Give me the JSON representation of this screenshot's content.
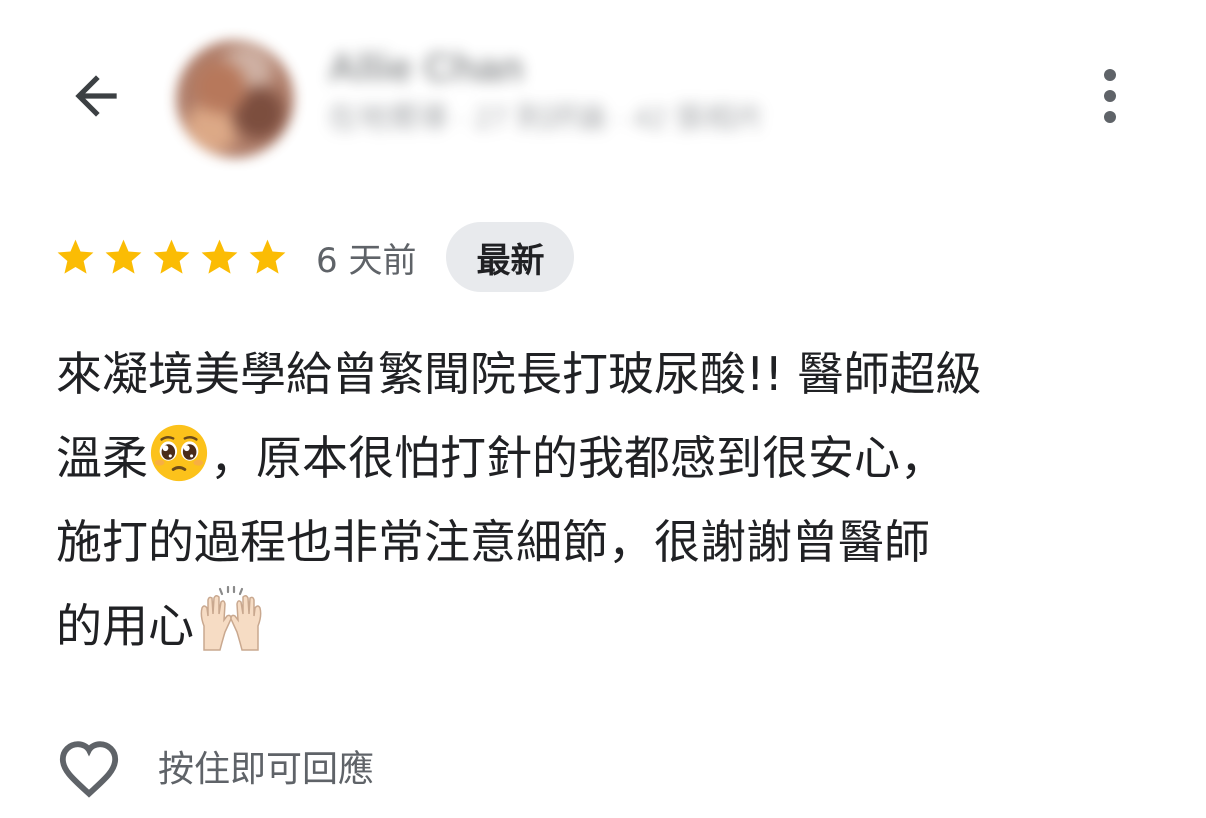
{
  "header": {
    "back_icon": "arrow-left-icon",
    "user_name": "Allie Chan",
    "user_meta": "在地嚮導 · 27 則評論 · 42 張相片",
    "more_icon": "more-vert-icon"
  },
  "review": {
    "rating": 5,
    "rating_max": 5,
    "star_color": "#fbbc04",
    "time": "6 天前",
    "badge": "最新",
    "lines": [
      "來凝境美學給曾繁聞院長打玻尿酸!! 醫師超級",
      "溫柔",
      "，原本很怕打針的我都感到很安心，",
      "施打的過程也非常注意細節，很謝謝曾醫師",
      "的用心"
    ],
    "emojis": [
      "pleading-face-emoji",
      "raising-hands-emoji"
    ]
  },
  "actions": {
    "like_icon": "heart-outline-icon",
    "like_label": "按住即可回應"
  }
}
